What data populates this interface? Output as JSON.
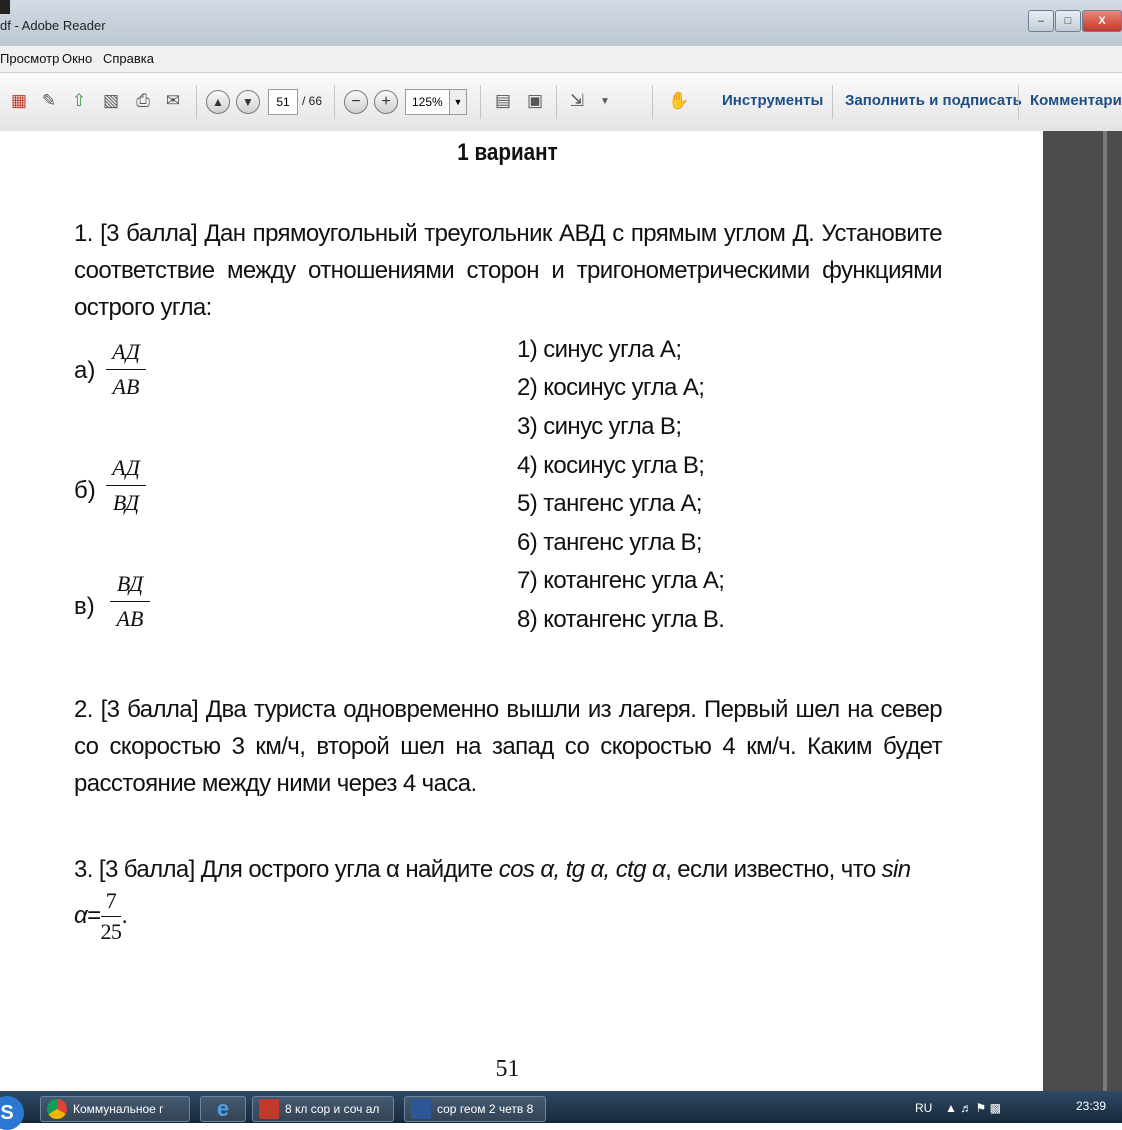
{
  "window": {
    "title": "df - Adobe Reader",
    "buttons": [
      "–",
      "□",
      "X"
    ]
  },
  "menu": [
    "Просмотр",
    "Окно",
    "Справка"
  ],
  "toolbar": {
    "page_current": "51",
    "page_total": "/ 66",
    "zoom": "125%",
    "tools_label": "Инструменты",
    "sign_label": "Заполнить и подписать",
    "comments_label": "Комментари"
  },
  "document": {
    "heading": "1 вариант",
    "task1": {
      "text": "1. [3 балла] Дан прямоугольный треугольник АВД с прямым углом Д. Установите соответствие между отношениями сторон и тригонометрическими функциями острого угла:",
      "items": [
        {
          "label": "а)",
          "num": "АД",
          "den": "АВ"
        },
        {
          "label": "б)",
          "num": "АД",
          "den": "ВД"
        },
        {
          "label": "в)",
          "num": "ВД",
          "den": "АВ"
        }
      ],
      "options": [
        "1) синус угла А;",
        "2) косинус угла А;",
        "3) синус угла В;",
        "4) косинус угла В;",
        "5) тангенс угла А;",
        "6) тангенс угла В;",
        "7) котангенс угла А;",
        "8) котангенс угла В."
      ]
    },
    "task2": {
      "text": "2. [3 балла] Два туриста одновременно вышли из лагеря. Первый шел на север со скоростью 3 км/ч, второй шел на запад со скоростью 4 км/ч. Каким будет расстояние между ними через 4 часа."
    },
    "task3": {
      "prefix": "3. [3 балла]  Для острого угла α найдите ",
      "funcs": "cos α, tg α, ctg α",
      "middle": ", если известно, что ",
      "given": "sin α",
      "eq": "=",
      "frac_num": "7",
      "frac_den": "25",
      "suffix": "."
    },
    "page_number": "51"
  },
  "taskbar": {
    "items": [
      "Коммунальное г",
      "8 кл сор и соч ал",
      "сор геом 2 четв 8"
    ],
    "lang": "RU",
    "time": "23:39"
  }
}
